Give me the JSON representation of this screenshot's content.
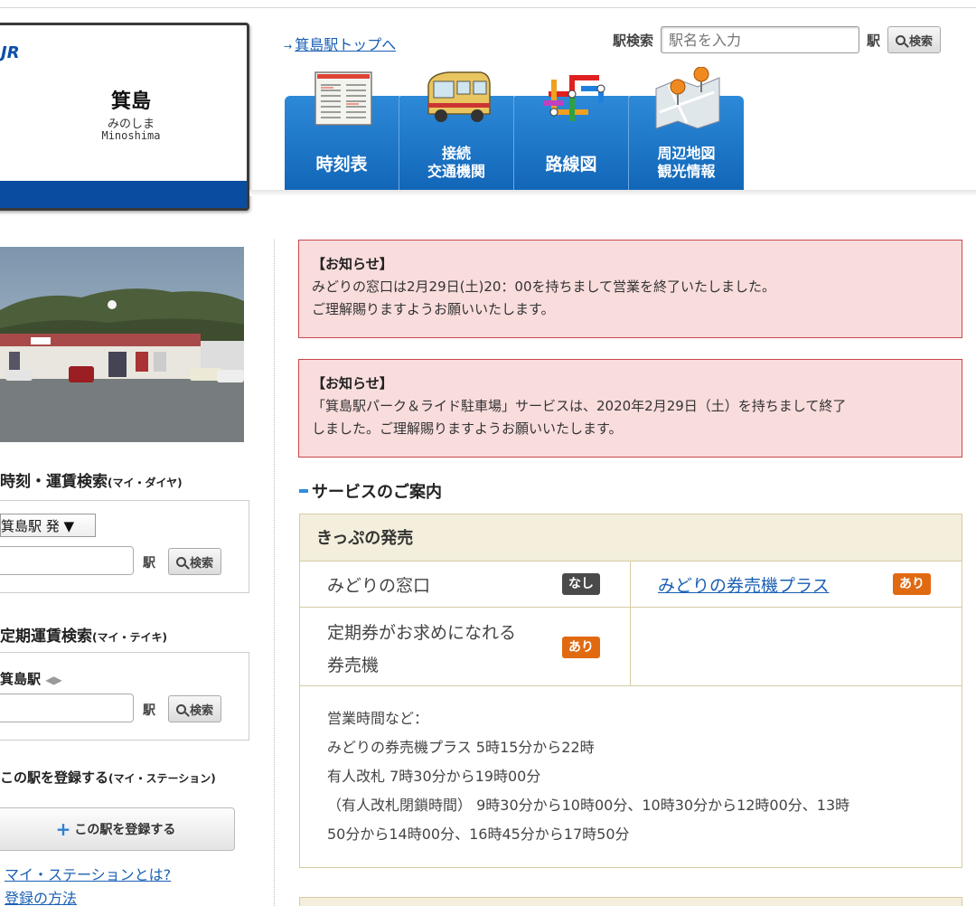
{
  "station": {
    "logo": "JR",
    "name_kanji": "箕島",
    "name_kana": "みのしま",
    "name_roman": "Minoshima"
  },
  "header": {
    "top_link": "箕島駅トップへ",
    "search_label": "駅検索",
    "search_placeholder": "駅名を入力",
    "search_suffix": "駅",
    "search_button": "検索"
  },
  "tabs": [
    {
      "label": "時刻表",
      "icon": "timetable-icon"
    },
    {
      "label1": "接続",
      "label2": "交通機関",
      "icon": "bus-icon"
    },
    {
      "label": "路線図",
      "icon": "route-map-icon"
    },
    {
      "label1": "周辺地図",
      "label2": "観光情報",
      "icon": "map-pin-icon"
    }
  ],
  "sidebar": {
    "timetable_title": "時刻・運賃検索",
    "timetable_sub": "(マイ・ダイヤ)",
    "from_select": "箕島駅 発 ▼",
    "eki": "駅",
    "search_button": "検索",
    "pass_title": "定期運賃検索",
    "pass_sub": "(マイ・テイキ)",
    "pass_station": "箕島駅",
    "register_title": "この駅を登録する",
    "register_sub": "(マイ・ステーション)",
    "register_button": "この駅を登録する",
    "link_what": "マイ・ステーションとは?",
    "link_how": "登録の方法"
  },
  "notices": [
    {
      "heading": "【お知らせ】",
      "line1": "みどりの窓口は2月29日(土)20：00を持ちまして営業を終了いたしました。",
      "line2": "ご理解賜りますようお願いいたします。"
    },
    {
      "heading": "【お知らせ】",
      "line1": "「箕島駅パーク＆ライド駐車場」サービスは、2020年2月29日（土）を持ちまして終了",
      "line2": "しました。ご理解賜りますようお願いいたします。"
    }
  ],
  "services": {
    "title": "サービスのご案内",
    "section": "きっぷの発売",
    "midori_window": "みどりの窓口",
    "midori_window_status": "なし",
    "midori_machine": "みどりの券売機プラス",
    "midori_machine_status": "あり",
    "pass_machine_1": "定期券がお求めになれる",
    "pass_machine_2": "券売機",
    "pass_machine_status": "あり",
    "hours": [
      "営業時間など：",
      "みどりの券売機プラス  5時15分から22時",
      "有人改札  7時30分から19時00分",
      "（有人改札閉鎖時間）  9時30分から10時00分、10時30分から12時00分、13時",
      "50分から14時00分、16時45分から17時50分"
    ]
  }
}
